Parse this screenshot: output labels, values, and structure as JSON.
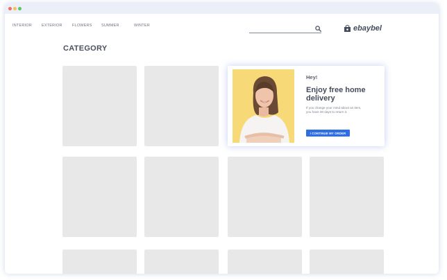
{
  "nav": {
    "items": [
      {
        "label": "INTERIOR"
      },
      {
        "label": "EXTERIOR"
      },
      {
        "label": "FLOWERS"
      },
      {
        "label": "SUMMER"
      },
      {
        "label": "WINTER"
      }
    ]
  },
  "header": {
    "logo_text": "ebaybel",
    "search_icon": "search-icon",
    "logo_icon": "shopping-bag-icon"
  },
  "page": {
    "title": "CATEGORY"
  },
  "popup": {
    "greeting": "Hey!",
    "headline": "Enjoy free home delivery",
    "body": "If you change your mind about an item, you have 30 days to return it.",
    "cta_label": "I CONTINUE MY ORDER",
    "cta_color": "#2d6de6"
  },
  "colors": {
    "tile": "#e8e8e8",
    "titlebar": "#ebeff7"
  }
}
